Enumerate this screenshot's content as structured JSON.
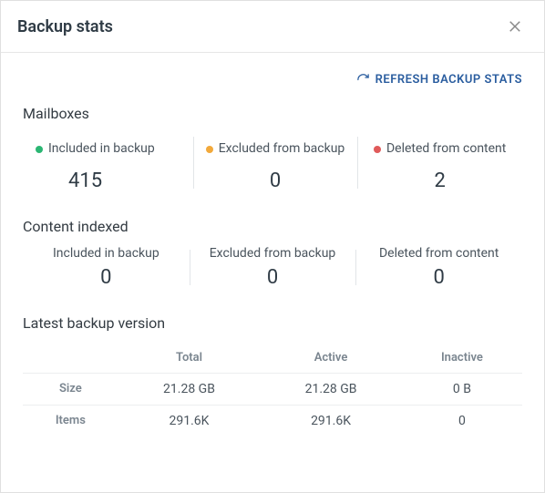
{
  "header": {
    "title": "Backup stats"
  },
  "refresh": {
    "label": "REFRESH BACKUP STATS"
  },
  "mailboxes": {
    "title": "Mailboxes",
    "included": {
      "label": "Included in backup",
      "value": "415"
    },
    "excluded": {
      "label": "Excluded from backup",
      "value": "0"
    },
    "deleted": {
      "label": "Deleted from content",
      "value": "2"
    }
  },
  "content_indexed": {
    "title": "Content indexed",
    "included": {
      "label": "Included in backup",
      "value": "0"
    },
    "excluded": {
      "label": "Excluded from backup",
      "value": "0"
    },
    "deleted": {
      "label": "Deleted from content",
      "value": "0"
    }
  },
  "latest_version": {
    "title": "Latest backup version",
    "columns": {
      "total": "Total",
      "active": "Active",
      "inactive": "Inactive"
    },
    "rows": {
      "size": {
        "label": "Size",
        "total": "21.28 GB",
        "active": "21.28 GB",
        "inactive": "0 B"
      },
      "items": {
        "label": "Items",
        "total": "291.6K",
        "active": "291.6K",
        "inactive": "0"
      }
    }
  }
}
